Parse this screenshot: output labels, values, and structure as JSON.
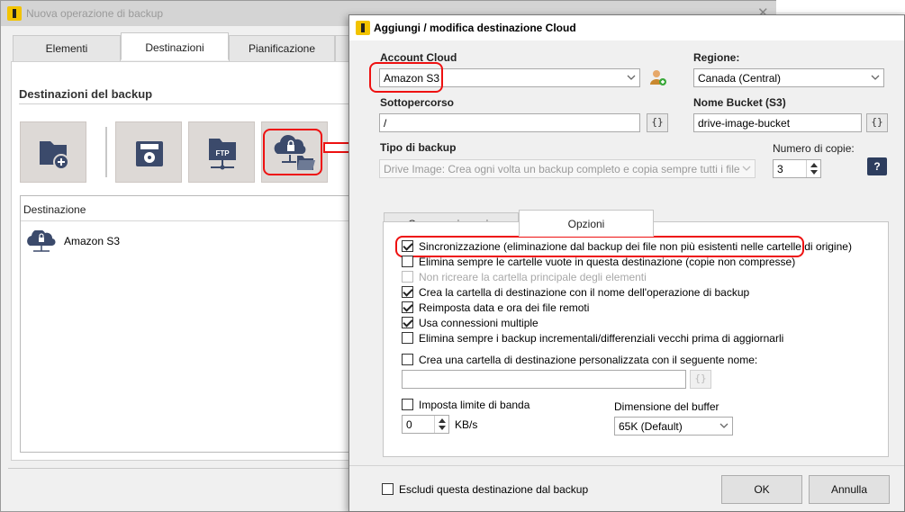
{
  "background_window": {
    "title": "Nuova operazione di backup",
    "close_glyph": "✕",
    "tabs": [
      "Elementi",
      "Destinazioni",
      "Pianificazione"
    ],
    "section_title": "Destinazioni del backup",
    "destination_buttons": [
      {
        "icon": "folder-add-icon"
      },
      {
        "icon": "disk-drive-icon"
      },
      {
        "icon": "ftp-server-icon"
      },
      {
        "icon": "cloud-folder-icon"
      }
    ],
    "list_header": "Destinazione",
    "list_items": [
      {
        "label": "Amazon S3",
        "icon": "cloud-lock-icon"
      }
    ]
  },
  "dialog": {
    "title": "Aggiungi / modifica destinazione Cloud",
    "account_cloud": {
      "label": "Account Cloud",
      "value": "Amazon S3"
    },
    "regione": {
      "label": "Regione:",
      "value": "Canada (Central)"
    },
    "sottopercorso": {
      "label": "Sottopercorso",
      "value": "/",
      "brace": "{}"
    },
    "nome_bucket": {
      "label": "Nome Bucket (S3)",
      "value": "drive-image-bucket",
      "brace": "{}"
    },
    "tipo_backup": {
      "label": "Tipo di backup",
      "value": "Drive Image: Crea ogni volta un backup completo e copia sempre tutti i file"
    },
    "numero_copie": {
      "label": "Numero di copie:",
      "value": "3"
    },
    "help": "?",
    "tabs": [
      "Compressione zip",
      "Opzioni"
    ],
    "options": [
      {
        "label": "Sincronizzazione (eliminazione dal backup dei file non più esistenti nelle cartelle di origine)",
        "checked": true,
        "disabled": false
      },
      {
        "label": "Elimina sempre le cartelle vuote in questa destinazione (copie non compresse)",
        "checked": false,
        "disabled": false
      },
      {
        "label": "Non ricreare la cartella principale degli elementi",
        "checked": false,
        "disabled": true
      },
      {
        "label": "Crea la cartella di destinazione con il nome dell'operazione di backup",
        "checked": true,
        "disabled": false
      },
      {
        "label": "Reimposta data e ora dei file remoti",
        "checked": true,
        "disabled": false
      },
      {
        "label": "Usa connessioni multiple",
        "checked": true,
        "disabled": false
      },
      {
        "label": "Elimina sempre i backup incrementali/differenziali vecchi prima di aggiornarli",
        "checked": false,
        "disabled": false
      }
    ],
    "custom_folder": {
      "label": "Crea una cartella di destinazione personalizzata con il seguente nome:",
      "checked": false,
      "value": "",
      "brace": "{}"
    },
    "bandwidth": {
      "label": "Imposta limite di banda",
      "checked": false,
      "value": "0",
      "unit": "KB/s"
    },
    "buffer": {
      "label": "Dimensione del buffer",
      "value": "65K (Default)"
    },
    "exclude": {
      "label": "Escludi questa destinazione dal backup",
      "checked": false
    },
    "ok_label": "OK",
    "cancel_label": "Annulla"
  },
  "colors": {
    "highlight": "#e11111",
    "app_icon": "#f2c300",
    "icon_navy": "#3b4a6b",
    "help_bg": "#2d3d5e"
  }
}
